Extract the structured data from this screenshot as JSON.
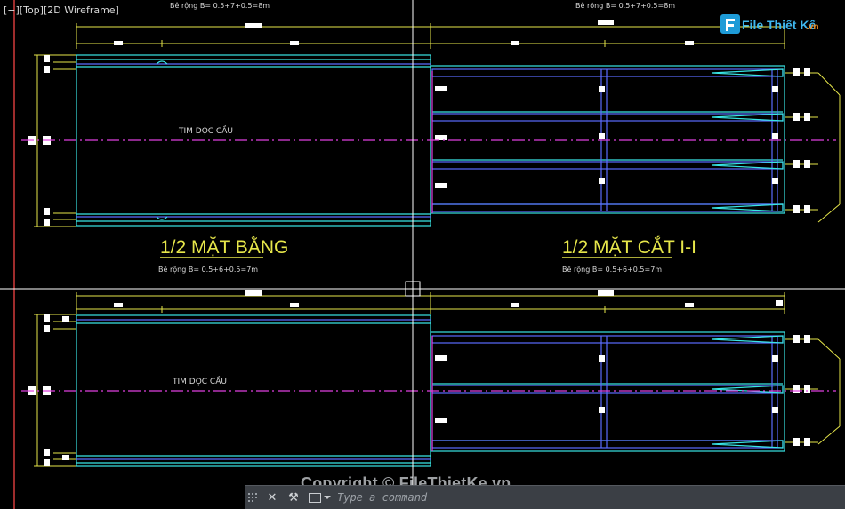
{
  "viewport": {
    "label": "[−][Top][2D Wireframe]"
  },
  "plan_top": {
    "dim_left": "Bê rộng B= 0.5+7+0.5=8m",
    "dim_right": "Bê rộng B= 0.5+7+0.5=8m",
    "axis_label": "TIM DỌC CẦU",
    "title_left": "1/2 MẶT BẰNG",
    "title_right": "1/2 MẶT CẮT I-I"
  },
  "plan_bottom": {
    "dim_left": "Bê rộng B= 0.5+6+0.5=7m",
    "dim_right": "Bê rộng B= 0.5+6+0.5=7m",
    "axis_label": "TIM DỌC CẦU"
  },
  "watermark": {
    "brand": "File Thiết Kế",
    "domain": ".vn",
    "copyright": "Copyright © FileThietKe.vn"
  },
  "command_line": {
    "placeholder": "Type a command",
    "close_label": "✕",
    "customize_label": "⚒"
  },
  "colors": {
    "background": "#000000",
    "cyan": "#39e6e6",
    "blue": "#5b6cff",
    "magenta": "#e040e0",
    "yellow": "#e6e64a",
    "white": "#ffffff",
    "crosshair": "#ffffff"
  }
}
